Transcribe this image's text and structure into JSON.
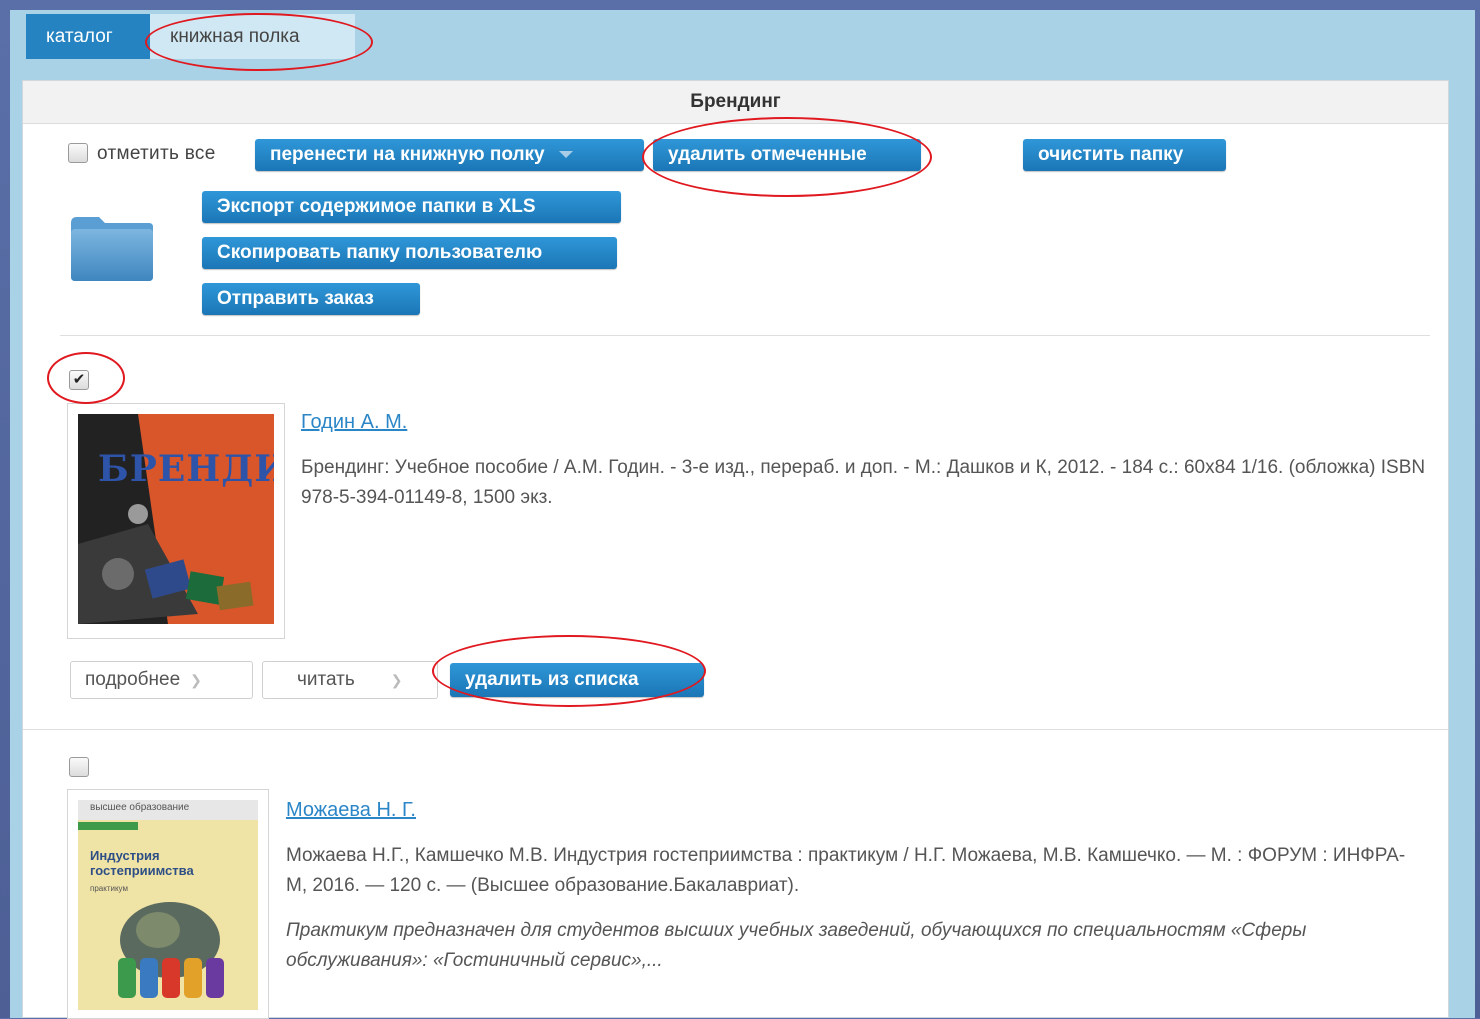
{
  "tabs": [
    {
      "label": "каталог"
    },
    {
      "label": "книжная полка"
    }
  ],
  "folder": {
    "title": "Брендинг",
    "select_all_label": "отметить все",
    "move_to_shelf_label": "перенести на книжную полку",
    "delete_selected_label": "удалить отмеченные",
    "clear_folder_label": "очистить папку",
    "export_label": "Экспорт содержимое папки в XLS",
    "copy_label": "Скопировать папку пользователю",
    "order_label": "Отправить заказ"
  },
  "books": [
    {
      "checked": true,
      "author": "Годин А. М.",
      "description": "Брендинг: Учебное пособие / А.М. Годин. - 3-е изд., перераб. и доп. - М.: Дашков и К, 2012. - 184 с.: 60x84 1/16. (обложка) ISBN 978-5-394-01149-8, 1500 экз.",
      "cover_title": "БРЕНДИНГ",
      "more_label": "подробнее",
      "read_label": "читать",
      "remove_label": "удалить из списка"
    },
    {
      "checked": false,
      "author": "Можаева Н. Г.",
      "description": "Можаева Н.Г., Камшечко М.В. Индустрия гостеприимства : практикум / Н.Г. Можаева, М.В. Камшечко. — М. : ФОРУМ : ИНФРА-М, 2016. — 120 с. — (Высшее образование.Бакалавриат).",
      "annotation": "Практикум предназначен для студентов высших учебных заведений, обучающихся по специальностям «Сферы обслуживания»: «Гостиничный сервис»,...",
      "cover_series": "высшее образование",
      "cover_title": "Индустрия гостеприимства",
      "cover_subtitle": "практикум"
    }
  ],
  "colors": {
    "primary_button": "#1f7fc0",
    "tab_active": "#2683c2",
    "app_background": "#a9d2e6",
    "annotation_circle": "#e0181f",
    "link": "#2b86c7"
  }
}
